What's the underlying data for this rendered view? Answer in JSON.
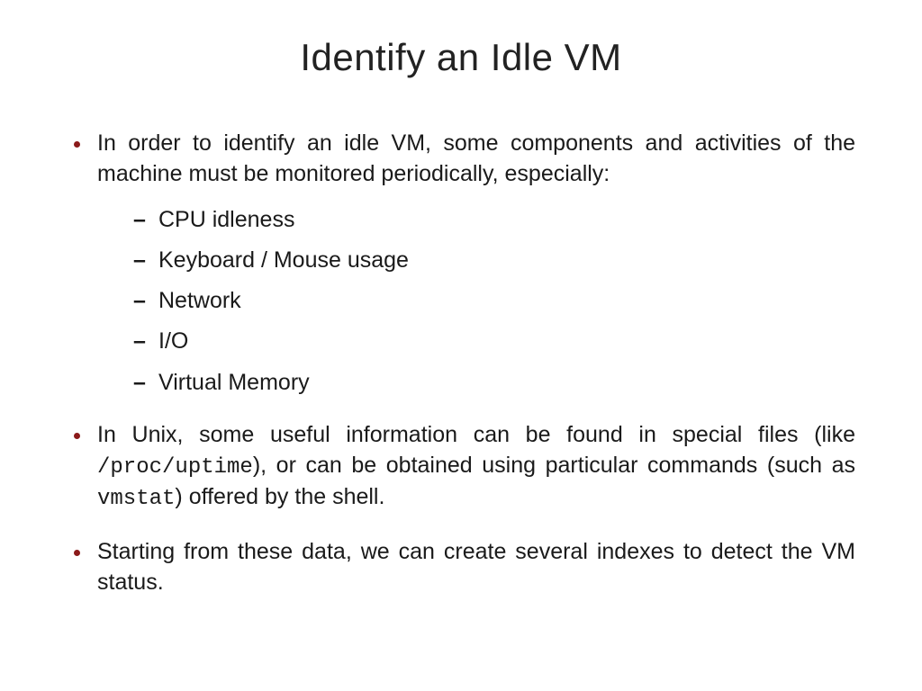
{
  "title": "Identify an Idle VM",
  "bullets": {
    "b1_pre": "In order to identify an idle VM, some components and activities of the machine must be monitored periodically, especially:",
    "b1_sub": {
      "s1": "CPU idleness",
      "s2": "Keyboard / Mouse usage",
      "s3": "Network",
      "s4": "I/O",
      "s5": "Virtual Memory"
    },
    "b2_p1": "In Unix, some useful information can be found in special files (like ",
    "b2_code1": "/proc/uptime",
    "b2_p2": "), or can be obtained using particular commands (such as ",
    "b2_code2": "vmstat",
    "b2_p3": ") offered by the shell.",
    "b3": "Starting from these data, we can create several indexes to detect the VM status."
  }
}
